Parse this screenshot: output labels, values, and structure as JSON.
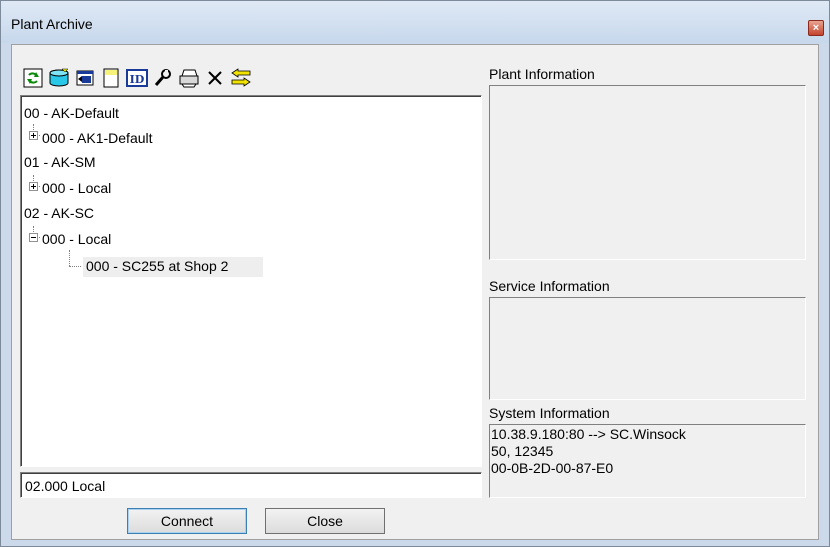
{
  "window": {
    "title": "Plant Archive",
    "close_glyph": "×"
  },
  "toolbar": {
    "buttons": [
      {
        "icon": "refresh-icon"
      },
      {
        "icon": "database-icon"
      },
      {
        "icon": "import-icon"
      },
      {
        "icon": "new-document-icon"
      },
      {
        "icon": "id-icon"
      },
      {
        "icon": "wrench-icon"
      },
      {
        "icon": "print-icon"
      },
      {
        "icon": "delete-icon"
      },
      {
        "icon": "transfer-icon"
      }
    ]
  },
  "tree": {
    "nodes": [
      {
        "label": "00 - AK-Default",
        "level": 0
      },
      {
        "label": "000 - AK1-Default",
        "level": 1,
        "expander": "plus"
      },
      {
        "label": "01 - AK-SM",
        "level": 0
      },
      {
        "label": "000 - Local",
        "level": 1,
        "expander": "plus"
      },
      {
        "label": "02 - AK-SC",
        "level": 0
      },
      {
        "label": "000 - Local",
        "level": 1,
        "expander": "minus"
      },
      {
        "label": "000 - SC255 at Shop 2",
        "level": 2,
        "selected": true
      }
    ]
  },
  "status_field": {
    "value": "02.000 Local"
  },
  "panels": {
    "plant_information_label": "Plant Information",
    "service_information_label": "Service Information",
    "system_information_label": "System Information",
    "system_information_lines": [
      "10.38.9.180:80 --> SC.Winsock",
      "50, 12345",
      "00-0B-2D-00-87-E0"
    ]
  },
  "buttons": {
    "connect_label": "Connect",
    "close_label": "Close"
  },
  "colors": {
    "title_bar": "#c7d8ec",
    "dialog_bg": "#f0f0f0",
    "close_button": "#c4432c"
  }
}
